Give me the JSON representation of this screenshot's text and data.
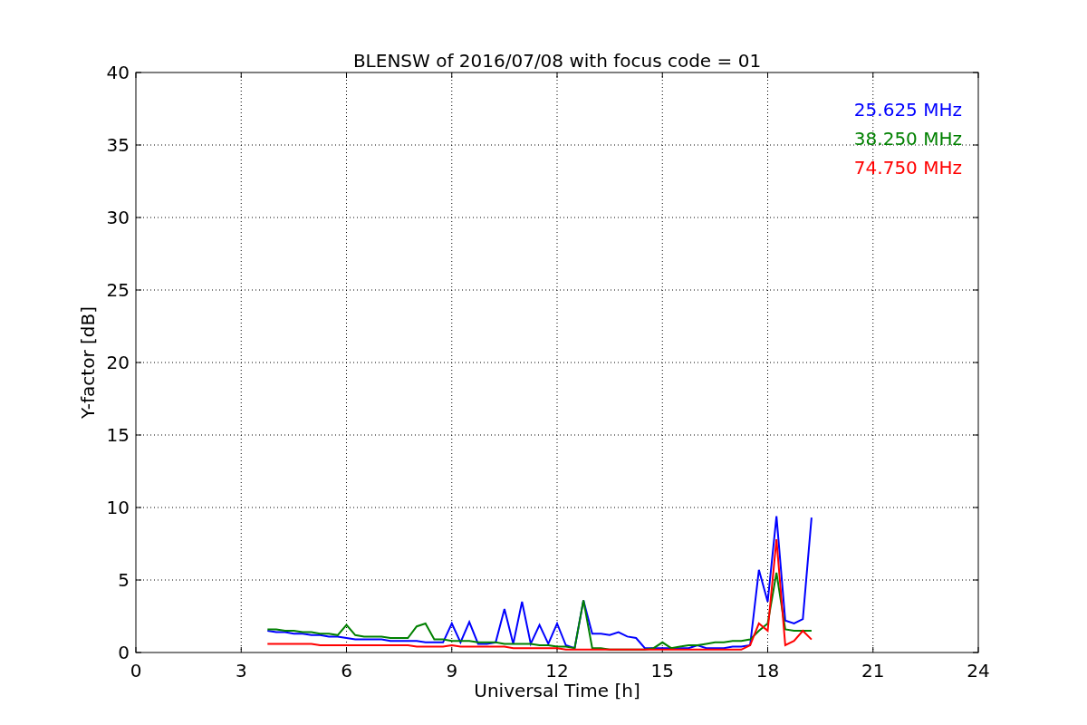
{
  "figure": {
    "chart_data": {
      "type": "line",
      "grid": true,
      "title": "BLENSW of 2016/07/08 with focus code = 01",
      "xlabel": "Universal Time [h]",
      "ylabel": "Y-factor [dB]",
      "xlim": [
        0,
        24
      ],
      "ylim": [
        0,
        40
      ],
      "xticks": [
        0,
        3,
        6,
        9,
        12,
        15,
        18,
        21,
        24
      ],
      "yticks": [
        0,
        5,
        10,
        15,
        20,
        25,
        30,
        35,
        40
      ],
      "x": [
        3.75,
        4.0,
        4.25,
        4.5,
        4.75,
        5.0,
        5.25,
        5.5,
        5.75,
        6.0,
        6.25,
        6.5,
        6.75,
        7.0,
        7.25,
        7.5,
        7.75,
        8.0,
        8.25,
        8.5,
        8.75,
        9.0,
        9.25,
        9.5,
        9.75,
        10.0,
        10.25,
        10.5,
        10.75,
        11.0,
        11.25,
        11.5,
        11.75,
        12.0,
        12.25,
        12.5,
        12.75,
        13.0,
        13.25,
        13.5,
        13.75,
        14.0,
        14.25,
        14.5,
        14.75,
        15.0,
        15.25,
        15.5,
        15.75,
        16.0,
        16.25,
        16.5,
        16.75,
        17.0,
        17.25,
        17.5,
        17.75,
        18.0,
        18.25,
        18.5,
        18.75,
        19.0,
        19.25
      ],
      "series": [
        {
          "name": "25.625 MHz",
          "color": "#0000ff",
          "values": [
            1.5,
            1.4,
            1.4,
            1.3,
            1.3,
            1.2,
            1.2,
            1.1,
            1.1,
            1.0,
            0.9,
            0.9,
            0.9,
            0.9,
            0.8,
            0.8,
            0.8,
            0.8,
            0.7,
            0.7,
            0.7,
            2.0,
            0.7,
            2.1,
            0.6,
            0.6,
            0.7,
            3.0,
            0.6,
            3.5,
            0.6,
            1.9,
            0.6,
            2.0,
            0.5,
            0.3,
            3.6,
            1.3,
            1.3,
            1.2,
            1.4,
            1.1,
            1.0,
            0.3,
            0.3,
            0.3,
            0.3,
            0.3,
            0.3,
            0.5,
            0.3,
            0.3,
            0.3,
            0.4,
            0.4,
            0.5,
            5.7,
            3.5,
            9.4,
            2.2,
            2.0,
            2.3,
            9.3
          ]
        },
        {
          "name": "38.250 MHz",
          "color": "#008000",
          "values": [
            1.6,
            1.6,
            1.5,
            1.5,
            1.4,
            1.4,
            1.3,
            1.3,
            1.2,
            1.9,
            1.2,
            1.1,
            1.1,
            1.1,
            1.0,
            1.0,
            1.0,
            1.8,
            2.0,
            0.9,
            0.9,
            0.8,
            0.8,
            0.8,
            0.7,
            0.7,
            0.7,
            0.6,
            0.6,
            0.6,
            0.6,
            0.5,
            0.5,
            0.4,
            0.4,
            0.3,
            3.6,
            0.3,
            0.3,
            0.2,
            0.2,
            0.2,
            0.2,
            0.2,
            0.3,
            0.7,
            0.3,
            0.4,
            0.5,
            0.5,
            0.6,
            0.7,
            0.7,
            0.8,
            0.8,
            0.9,
            1.5,
            2.0,
            5.5,
            1.6,
            1.5,
            1.5,
            1.5
          ]
        },
        {
          "name": "74.750 MHz",
          "color": "#ff0000",
          "values": [
            0.6,
            0.6,
            0.6,
            0.6,
            0.6,
            0.6,
            0.5,
            0.5,
            0.5,
            0.5,
            0.5,
            0.5,
            0.5,
            0.5,
            0.5,
            0.5,
            0.5,
            0.4,
            0.4,
            0.4,
            0.4,
            0.5,
            0.4,
            0.4,
            0.4,
            0.4,
            0.4,
            0.4,
            0.3,
            0.3,
            0.3,
            0.3,
            0.3,
            0.3,
            0.2,
            0.2,
            0.2,
            0.2,
            0.2,
            0.2,
            0.2,
            0.2,
            0.2,
            0.2,
            0.2,
            0.2,
            0.2,
            0.2,
            0.2,
            0.2,
            0.2,
            0.2,
            0.2,
            0.2,
            0.2,
            0.5,
            2.0,
            1.5,
            7.8,
            0.5,
            0.8,
            1.5,
            0.9
          ]
        }
      ]
    }
  }
}
